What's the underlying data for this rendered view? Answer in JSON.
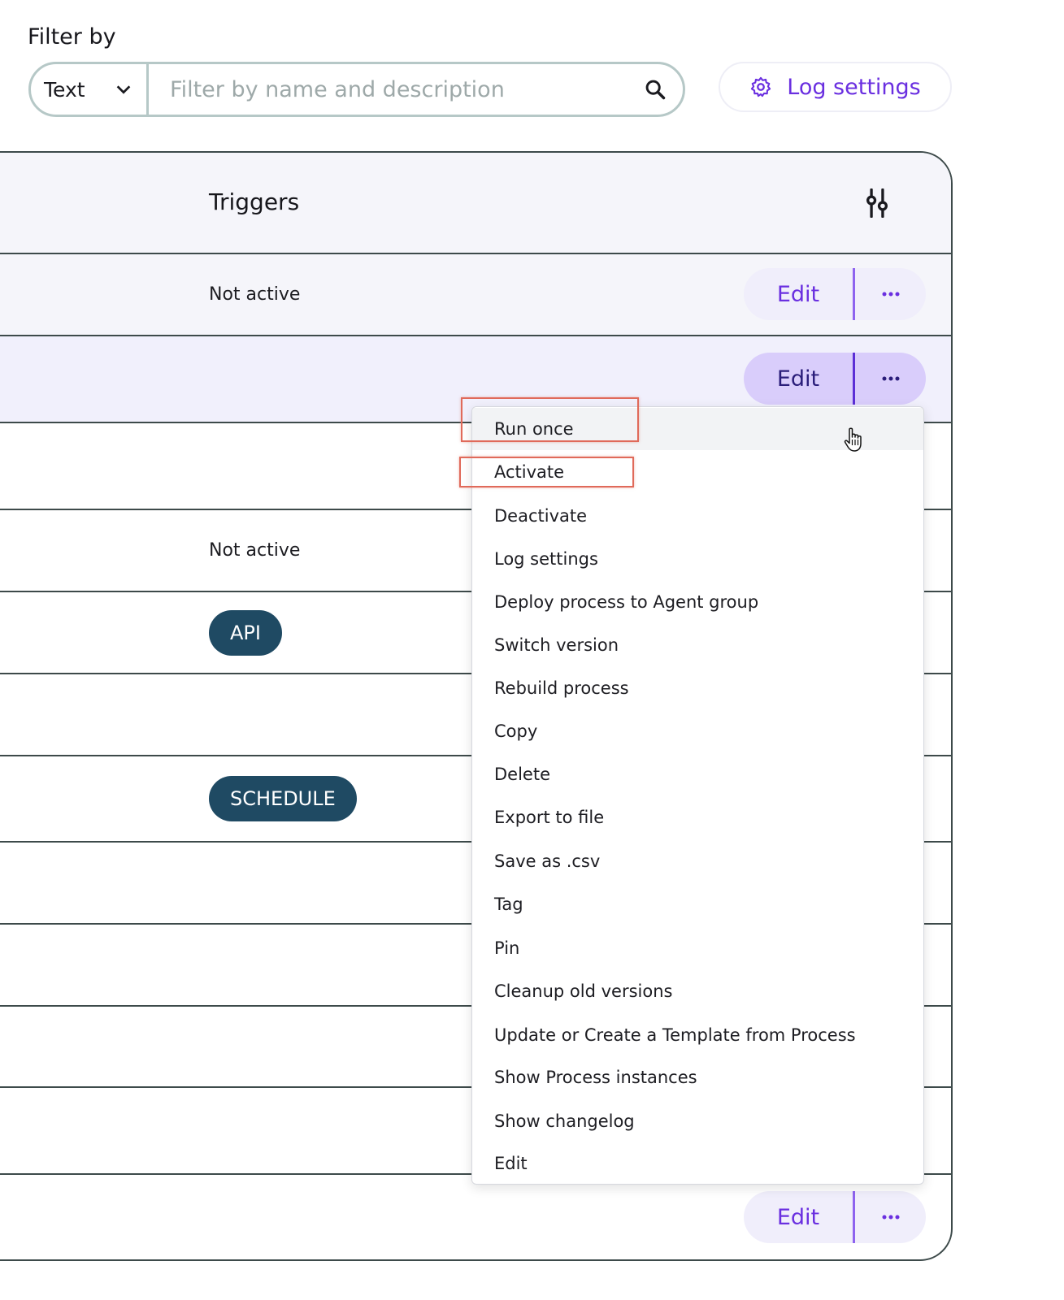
{
  "filter": {
    "label": "Filter by",
    "type_select": "Text",
    "placeholder": "Filter by name and description"
  },
  "log_settings_button": "Log settings",
  "table": {
    "header": "Triggers",
    "rows": [
      {
        "status": "Not active",
        "edit": "Edit"
      },
      {
        "status": "",
        "edit": "Edit"
      },
      {
        "status": "",
        "edit": ""
      },
      {
        "status": "Not active",
        "edit": ""
      },
      {
        "pill": "API"
      },
      {
        "status": ""
      },
      {
        "pill": "SCHEDULE"
      },
      {
        "status": ""
      },
      {
        "status": ""
      },
      {
        "status": ""
      },
      {
        "status": ""
      },
      {
        "status": "",
        "edit": "Edit"
      }
    ]
  },
  "menu": {
    "items": [
      "Run once",
      "Activate",
      "Deactivate",
      "Log settings",
      "Deploy process to Agent group",
      "Switch version",
      "Rebuild process",
      "Copy",
      "Delete",
      "Export to file",
      "Save as .csv",
      "Tag",
      "Pin",
      "Cleanup old versions",
      "Update or Create a Template from Process",
      "Show Process instances",
      "Show changelog",
      "Edit"
    ]
  },
  "colors": {
    "accent": "#6a2fe0",
    "pill": "#1f4a63",
    "highlight": "#e06a5a"
  }
}
